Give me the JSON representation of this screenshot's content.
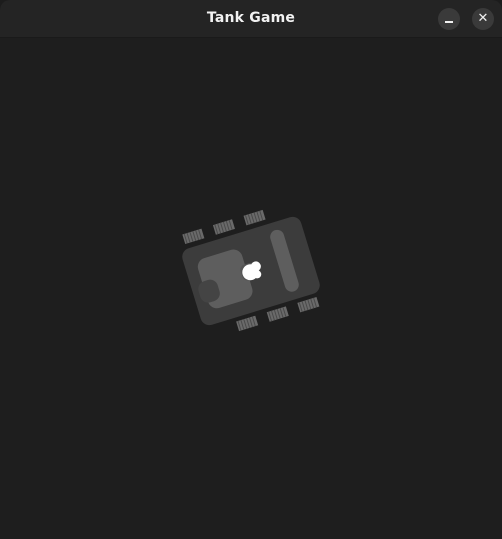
{
  "window": {
    "title": "Tank Game",
    "minimize_icon": "minimize-icon",
    "close_icon": "close-icon"
  },
  "colors": {
    "background": "#1e1e1e",
    "titlebar": "#242424",
    "hull": "#3c3c3c",
    "turret": "#5e5e5e",
    "tread": "#6e6e6e",
    "muzzle_flash": "#ffffff"
  },
  "game": {
    "player_tank": {
      "icon": "tank-icon"
    }
  }
}
